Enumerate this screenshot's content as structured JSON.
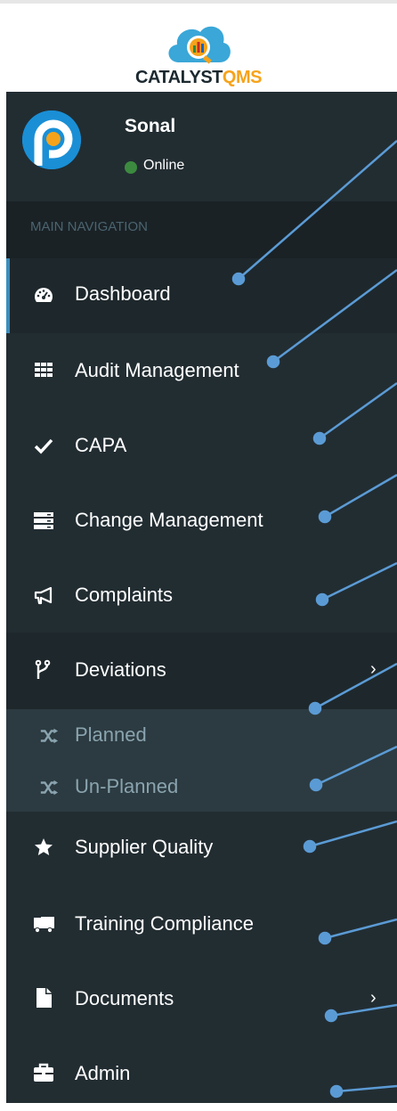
{
  "brand": {
    "name_part1": "CATALYST",
    "name_part2": "QMS",
    "colors": {
      "dark": "#1c2930",
      "accent": "#f6a31b",
      "cloud": "#3aa7d8"
    }
  },
  "user": {
    "name": "Sonal",
    "status": "Online",
    "status_color": "#3c8a3f"
  },
  "nav": {
    "header": "MAIN NAVIGATION",
    "items": [
      {
        "label": "Dashboard",
        "icon": "dashboard-icon",
        "active": true
      },
      {
        "label": "Audit Management",
        "icon": "grid-icon"
      },
      {
        "label": "CAPA",
        "icon": "check-icon"
      },
      {
        "label": "Change Management",
        "icon": "server-icon"
      },
      {
        "label": "Complaints",
        "icon": "bullhorn-icon"
      },
      {
        "label": "Deviations",
        "icon": "code-fork-icon",
        "expanded": true,
        "children": [
          {
            "label": "Planned",
            "icon": "random-icon"
          },
          {
            "label": "Un-Planned",
            "icon": "random-icon"
          }
        ]
      },
      {
        "label": "Supplier Quality",
        "icon": "star-icon"
      },
      {
        "label": "Training Compliance",
        "icon": "truck-icon"
      },
      {
        "label": "Documents",
        "icon": "file-icon",
        "has_children": true
      },
      {
        "label": "Admin",
        "icon": "briefcase-icon"
      }
    ]
  },
  "theme": {
    "sidebar_bg": "#222d32",
    "active_bg": "#1e282c",
    "active_border": "#3c8dbc",
    "submenu_bg": "#2c3b41",
    "annotation": "#5b9bd5"
  }
}
